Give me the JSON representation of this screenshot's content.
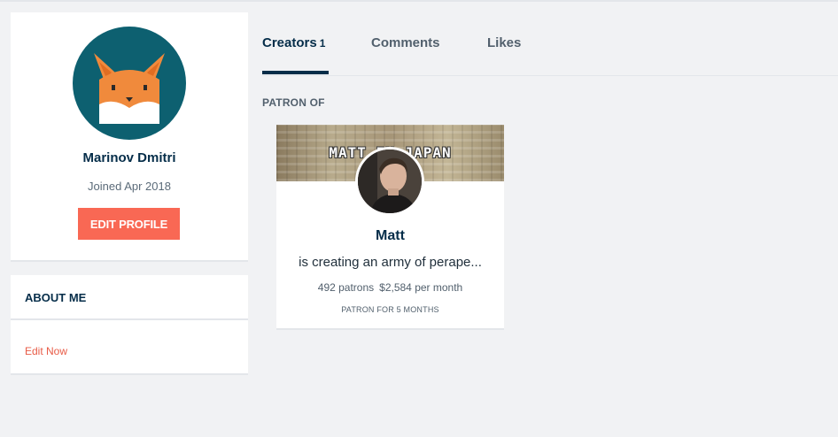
{
  "profile": {
    "name": "Marinov Dmitri",
    "joined": "Joined Apr 2018",
    "edit_button": "EDIT PROFILE",
    "avatar_icon": "fox-avatar-icon"
  },
  "about": {
    "title": "ABOUT ME",
    "edit_link": "Edit Now"
  },
  "tabs": [
    {
      "label": "Creators",
      "count": "1",
      "active": true
    },
    {
      "label": "Comments",
      "count": "",
      "active": false
    },
    {
      "label": "Likes",
      "count": "",
      "active": false
    }
  ],
  "section": {
    "label": "PATRON OF"
  },
  "creator": {
    "banner_text": "MATT IN JAPAN",
    "name": "Matt",
    "tagline": "is creating an army of perape...",
    "patrons": "492 patrons",
    "per_month": "$2,584 per month",
    "duration": "PATRON FOR 5 MONTHS"
  },
  "colors": {
    "accent": "#f96854",
    "navy": "#052d49",
    "avatar_bg": "#0d6070",
    "fox": "#f08a3c"
  }
}
